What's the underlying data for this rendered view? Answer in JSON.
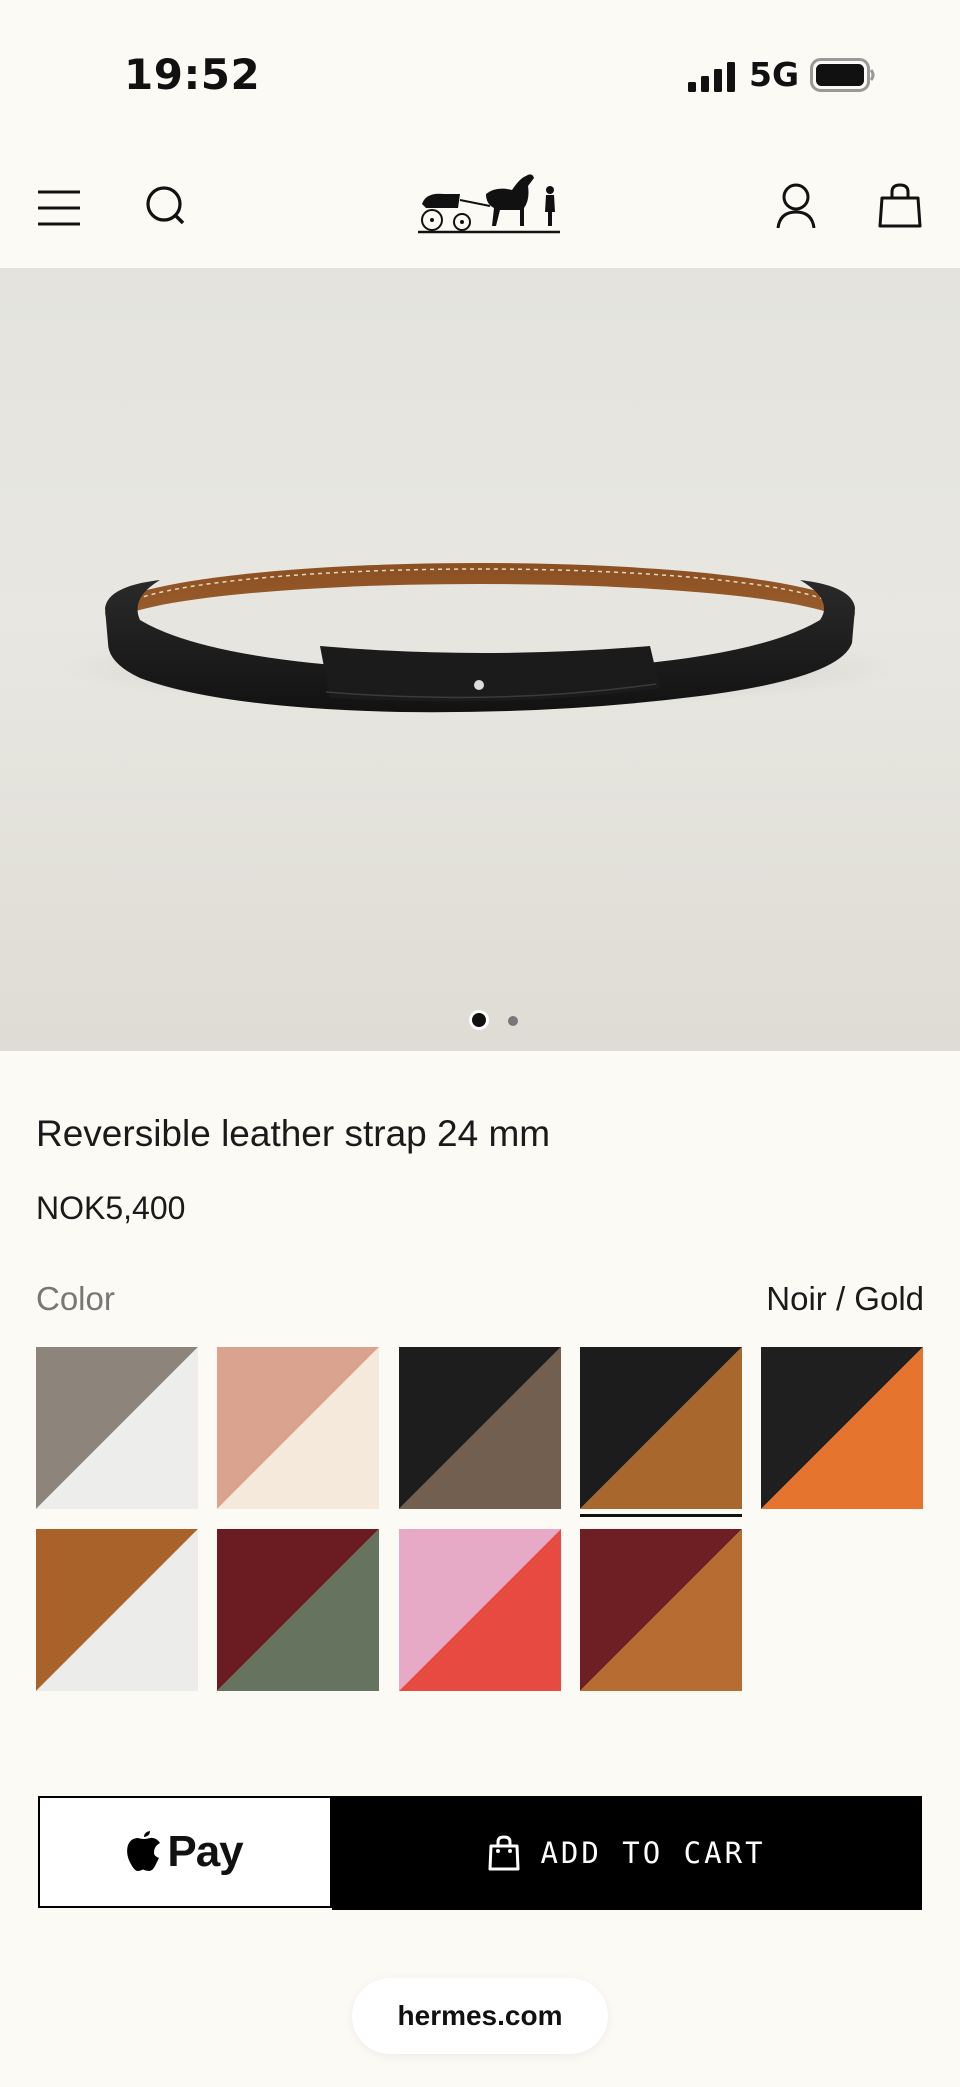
{
  "status_bar": {
    "time": "19:52",
    "network": "5G",
    "icons": [
      "signal-bars-icon",
      "battery-icon"
    ]
  },
  "header": {
    "icons": [
      "menu-icon",
      "search-icon",
      "hermes-logo",
      "account-icon",
      "bag-icon"
    ]
  },
  "gallery": {
    "page_count": 2,
    "current_page": 1
  },
  "product": {
    "title": "Reversible leather strap 24 mm",
    "price": "NOK5,400",
    "color_label": "Color",
    "selected_color": "Noir / Gold"
  },
  "swatches": [
    {
      "id": "swatch-1",
      "top": "#8d847b",
      "bottom": "#ededeb",
      "selected": false
    },
    {
      "id": "swatch-2",
      "top": "#d9a38f",
      "bottom": "#f5e9dc",
      "selected": false
    },
    {
      "id": "swatch-3",
      "top": "#1d1d1d",
      "bottom": "#725f50",
      "selected": false
    },
    {
      "id": "swatch-4",
      "top": "#1c1c1c",
      "bottom": "#a8682d",
      "selected": true
    },
    {
      "id": "swatch-5",
      "top": "#1f1f1f",
      "bottom": "#e5742f",
      "selected": false
    },
    {
      "id": "swatch-6",
      "top": "#a9622a",
      "bottom": "#ececea",
      "selected": false
    },
    {
      "id": "swatch-7",
      "top": "#6b1c22",
      "bottom": "#66745f",
      "selected": false
    },
    {
      "id": "swatch-8",
      "top": "#e6a9c6",
      "bottom": "#e64a40",
      "selected": false
    },
    {
      "id": "swatch-9",
      "top": "#6d1f24",
      "bottom": "#b76c32",
      "selected": false
    }
  ],
  "actions": {
    "apple_pay_label": "Pay",
    "add_to_cart_label": "ADD TO CART"
  },
  "browser": {
    "url": "hermes.com"
  },
  "colors": {
    "background": "#fcfaf5",
    "button_black": "#000000",
    "belt_black": "#1b1b1b",
    "belt_tan": "#9a5d2c"
  }
}
